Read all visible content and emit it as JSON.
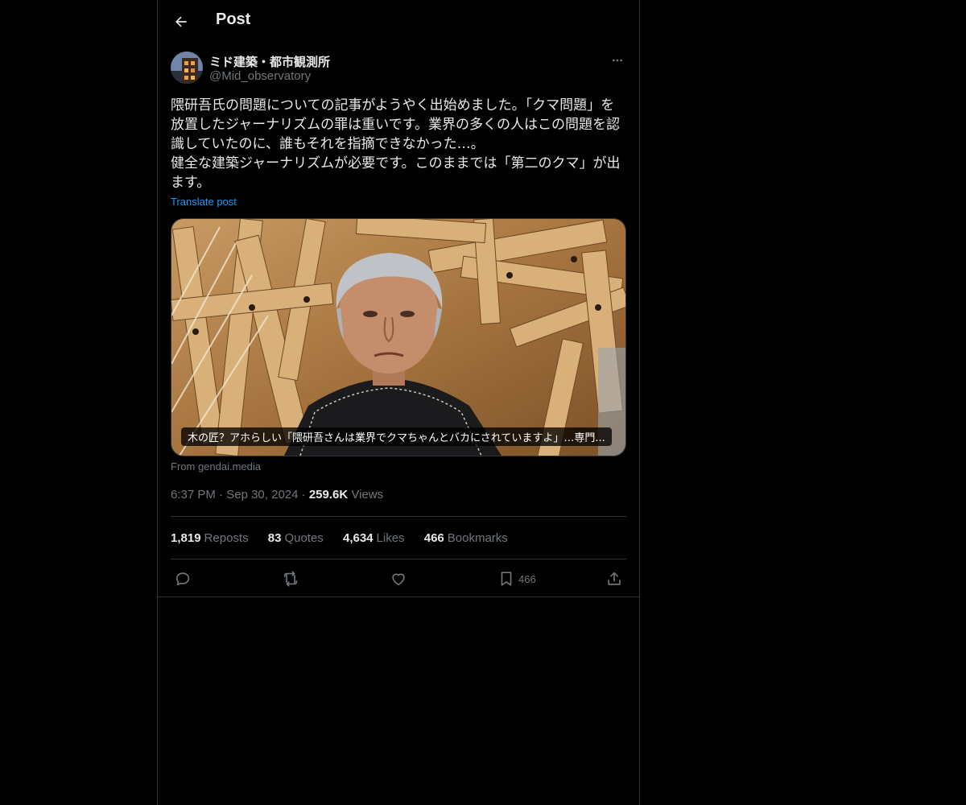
{
  "header": {
    "title": "Post",
    "back_icon": "arrow-left-icon"
  },
  "author": {
    "display_name": "ミド建築・都市観測所",
    "handle": "@Mid_observatory",
    "avatar_icon": "building-avatar"
  },
  "post": {
    "text": "隈研吾氏の問題についての記事がようやく出始めました。「クマ問題」を放置したジャーナリズムの罪は重いです。業界の多くの人はこの問題を認識していたのに、誰もそれを指摘できなかった…。\n健全な建築ジャーナリズムが必要です。このままでは「第二のクマ」が出ます。",
    "translate_label": "Translate post",
    "media_caption": "木の匠？アホらしい「隈研吾さんは業界でクマちゃんとバカにされていますよ」…専門...",
    "source_label": "From gendai.media",
    "time": "6:37 PM",
    "date": "Sep 30, 2024",
    "views_count": "259.6K",
    "views_label": "Views",
    "separator": "·"
  },
  "stats": {
    "reposts_count": "1,819",
    "reposts_label": "Reposts",
    "quotes_count": "83",
    "quotes_label": "Quotes",
    "likes_count": "4,634",
    "likes_label": "Likes",
    "bookmarks_count": "466",
    "bookmarks_label": "Bookmarks"
  },
  "actions": {
    "reply_icon": "reply-icon",
    "repost_icon": "repost-icon",
    "like_icon": "heart-icon",
    "bookmark_icon": "bookmark-icon",
    "bookmark_count": "466",
    "share_icon": "share-icon"
  },
  "colors": {
    "background": "#000000",
    "text": "#e7e9ea",
    "muted": "#71767b",
    "link": "#1d9bf0",
    "border": "#2f3336"
  }
}
